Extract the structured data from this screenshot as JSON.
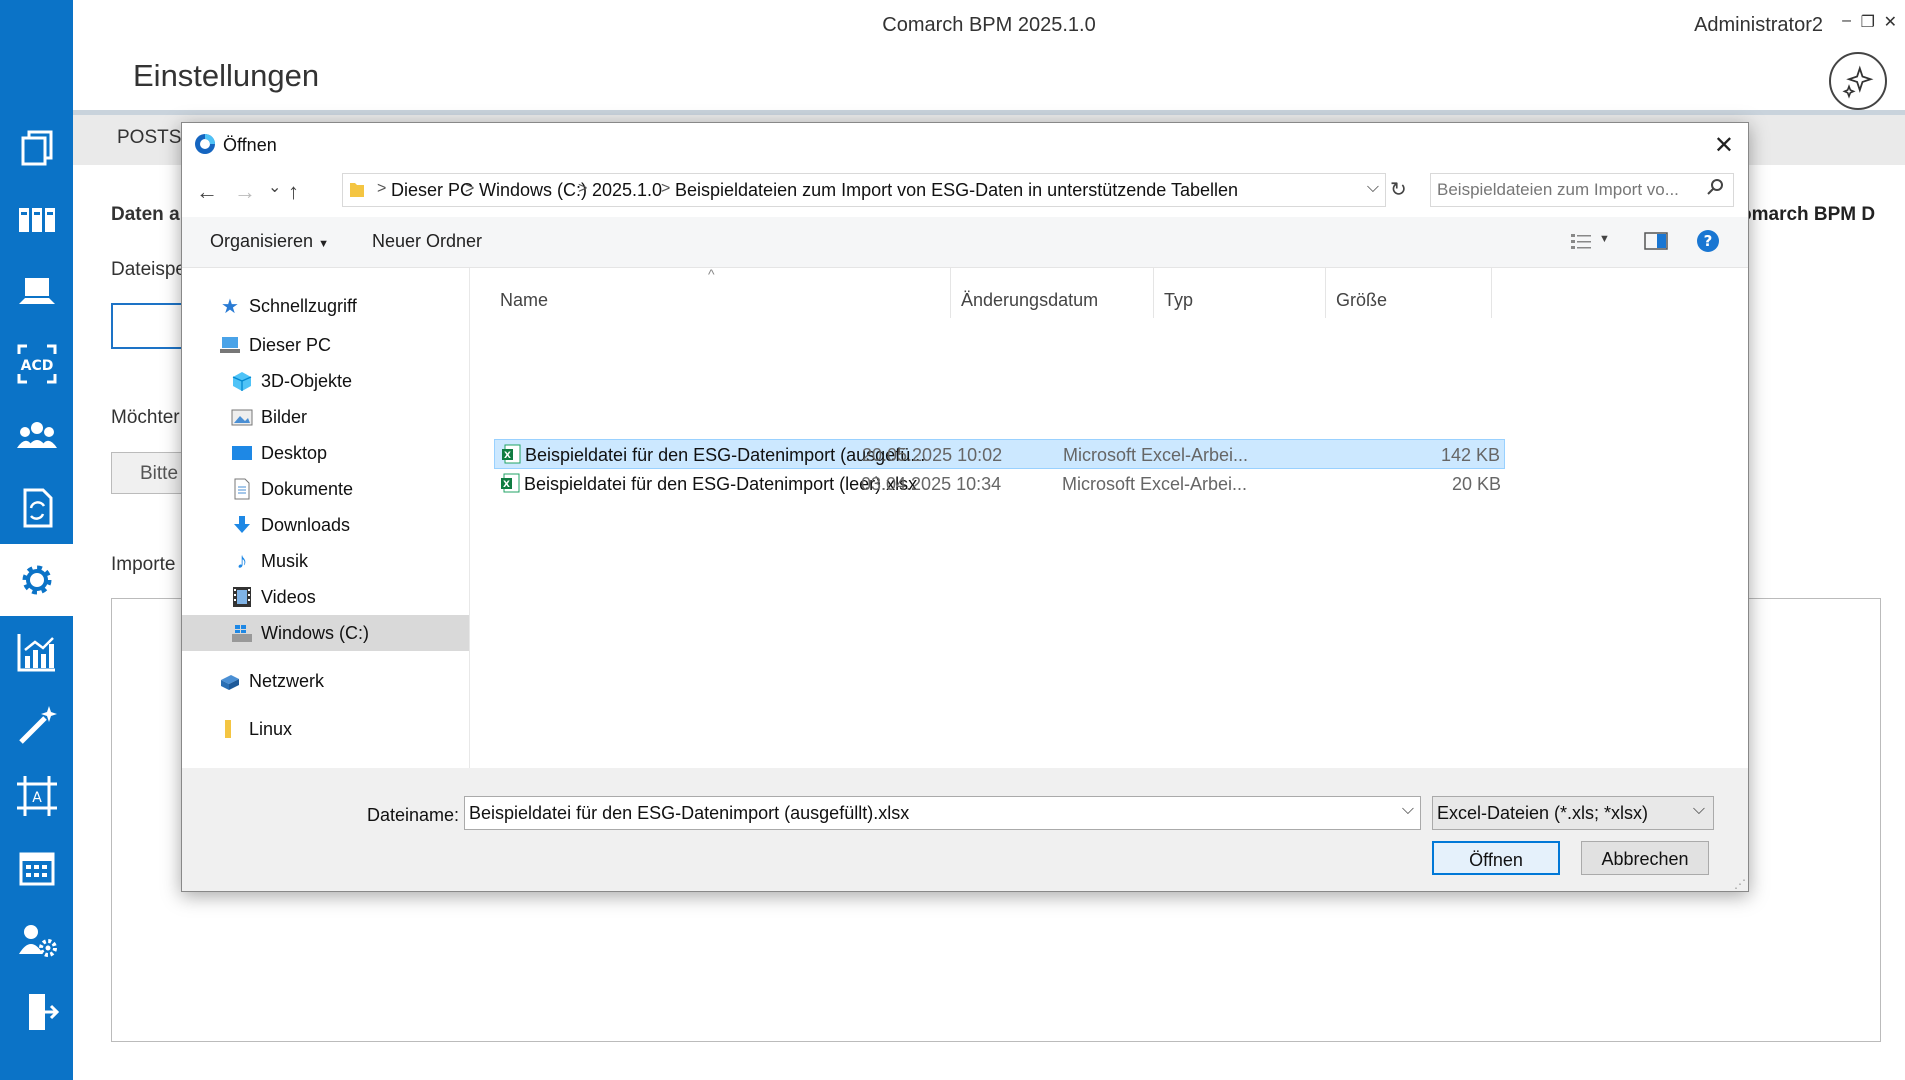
{
  "app": {
    "title": "Comarch BPM 2025.1.0",
    "user": "Administrator2",
    "page_title": "Einstellungen",
    "tab_label": "POSTSE",
    "bg_section_heading": "Daten a",
    "bg_field_label": "Dateispe",
    "bg_question": "Möchter",
    "bg_button": "Bitte",
    "bg_import_label": "Importe",
    "bg_right_text": "omarch BPM D",
    "window_controls": {
      "minimize": "–",
      "restore": "❐",
      "close": "✕"
    },
    "accent_color": "#0b73c7"
  },
  "sidebar": {
    "items": [
      {
        "name": "documents-icon"
      },
      {
        "name": "library-icon"
      },
      {
        "name": "workstation-icon"
      },
      {
        "name": "acd-icon"
      },
      {
        "name": "users-icon"
      },
      {
        "name": "document-sync-icon"
      },
      {
        "name": "settings-icon",
        "active": true
      },
      {
        "name": "analytics-icon"
      },
      {
        "name": "magic-wand-icon"
      },
      {
        "name": "template-designer-icon"
      },
      {
        "name": "calendar-icon"
      },
      {
        "name": "user-settings-icon"
      },
      {
        "name": "logout-icon"
      }
    ]
  },
  "dialog": {
    "title": "Öffnen",
    "close": "✕",
    "nav": {
      "back": "←",
      "forward": "→",
      "history": "⌄",
      "up": "↑"
    },
    "breadcrumb": [
      "Dieser PC",
      "Windows (C:)",
      "2025.1.0",
      "Beispieldateien zum Import von ESG-Daten in unterstützende Tabellen"
    ],
    "search_placeholder": "Beispieldateien zum Import vo...",
    "toolbar": {
      "organize": "Organisieren",
      "new_folder": "Neuer Ordner"
    },
    "nav_tree": [
      {
        "label": "Schnellzugriff",
        "icon": "quick-access-icon"
      },
      {
        "label": "Dieser PC",
        "icon": "pc-icon"
      },
      {
        "label": "3D-Objekte",
        "icon": "3d-objects-icon"
      },
      {
        "label": "Bilder",
        "icon": "pictures-icon"
      },
      {
        "label": "Desktop",
        "icon": "desktop-icon"
      },
      {
        "label": "Dokumente",
        "icon": "documents-folder-icon"
      },
      {
        "label": "Downloads",
        "icon": "downloads-icon"
      },
      {
        "label": "Musik",
        "icon": "music-icon"
      },
      {
        "label": "Videos",
        "icon": "videos-icon"
      },
      {
        "label": "Windows (C:)",
        "icon": "drive-icon",
        "selected": true
      },
      {
        "label": "Netzwerk",
        "icon": "network-icon"
      },
      {
        "label": "Linux",
        "icon": "folder-icon"
      }
    ],
    "columns": {
      "name": "Name",
      "date": "Änderungsdatum",
      "type": "Typ",
      "size": "Größe"
    },
    "files": [
      {
        "name": "Beispieldatei für den ESG-Datenimport (ausgefü...",
        "date": "20.05.2025 10:02",
        "type": "Microsoft Excel-Arbei...",
        "size": "142 KB",
        "selected": true
      },
      {
        "name": "Beispieldatei für den ESG-Datenimport (leer).xlsx",
        "date": "03.04.2025 10:34",
        "type": "Microsoft Excel-Arbei...",
        "size": "20 KB",
        "selected": false
      }
    ],
    "filename_label": "Dateiname:",
    "filename_value": "Beispieldatei für den ESG-Datenimport (ausgefüllt).xlsx",
    "filetype_value": "Excel-Dateien (*.xls; *xlsx)",
    "open_button": "Öffnen",
    "cancel_button": "Abbrechen"
  }
}
